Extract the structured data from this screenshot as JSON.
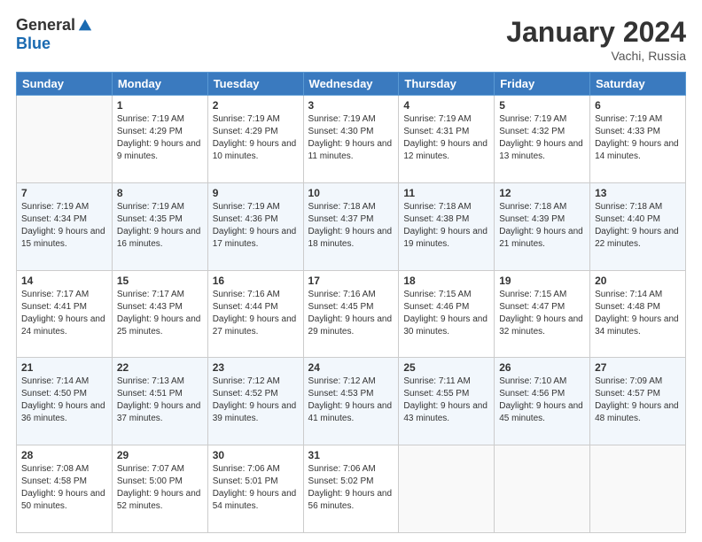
{
  "logo": {
    "general": "General",
    "blue": "Blue"
  },
  "title": "January 2024",
  "location": "Vachi, Russia",
  "days_of_week": [
    "Sunday",
    "Monday",
    "Tuesday",
    "Wednesday",
    "Thursday",
    "Friday",
    "Saturday"
  ],
  "weeks": [
    [
      {
        "day": "",
        "sunrise": "",
        "sunset": "",
        "daylight": ""
      },
      {
        "day": "1",
        "sunrise": "Sunrise: 7:19 AM",
        "sunset": "Sunset: 4:29 PM",
        "daylight": "Daylight: 9 hours and 9 minutes."
      },
      {
        "day": "2",
        "sunrise": "Sunrise: 7:19 AM",
        "sunset": "Sunset: 4:29 PM",
        "daylight": "Daylight: 9 hours and 10 minutes."
      },
      {
        "day": "3",
        "sunrise": "Sunrise: 7:19 AM",
        "sunset": "Sunset: 4:30 PM",
        "daylight": "Daylight: 9 hours and 11 minutes."
      },
      {
        "day": "4",
        "sunrise": "Sunrise: 7:19 AM",
        "sunset": "Sunset: 4:31 PM",
        "daylight": "Daylight: 9 hours and 12 minutes."
      },
      {
        "day": "5",
        "sunrise": "Sunrise: 7:19 AM",
        "sunset": "Sunset: 4:32 PM",
        "daylight": "Daylight: 9 hours and 13 minutes."
      },
      {
        "day": "6",
        "sunrise": "Sunrise: 7:19 AM",
        "sunset": "Sunset: 4:33 PM",
        "daylight": "Daylight: 9 hours and 14 minutes."
      }
    ],
    [
      {
        "day": "7",
        "sunrise": "Sunrise: 7:19 AM",
        "sunset": "Sunset: 4:34 PM",
        "daylight": "Daylight: 9 hours and 15 minutes."
      },
      {
        "day": "8",
        "sunrise": "Sunrise: 7:19 AM",
        "sunset": "Sunset: 4:35 PM",
        "daylight": "Daylight: 9 hours and 16 minutes."
      },
      {
        "day": "9",
        "sunrise": "Sunrise: 7:19 AM",
        "sunset": "Sunset: 4:36 PM",
        "daylight": "Daylight: 9 hours and 17 minutes."
      },
      {
        "day": "10",
        "sunrise": "Sunrise: 7:18 AM",
        "sunset": "Sunset: 4:37 PM",
        "daylight": "Daylight: 9 hours and 18 minutes."
      },
      {
        "day": "11",
        "sunrise": "Sunrise: 7:18 AM",
        "sunset": "Sunset: 4:38 PM",
        "daylight": "Daylight: 9 hours and 19 minutes."
      },
      {
        "day": "12",
        "sunrise": "Sunrise: 7:18 AM",
        "sunset": "Sunset: 4:39 PM",
        "daylight": "Daylight: 9 hours and 21 minutes."
      },
      {
        "day": "13",
        "sunrise": "Sunrise: 7:18 AM",
        "sunset": "Sunset: 4:40 PM",
        "daylight": "Daylight: 9 hours and 22 minutes."
      }
    ],
    [
      {
        "day": "14",
        "sunrise": "Sunrise: 7:17 AM",
        "sunset": "Sunset: 4:41 PM",
        "daylight": "Daylight: 9 hours and 24 minutes."
      },
      {
        "day": "15",
        "sunrise": "Sunrise: 7:17 AM",
        "sunset": "Sunset: 4:43 PM",
        "daylight": "Daylight: 9 hours and 25 minutes."
      },
      {
        "day": "16",
        "sunrise": "Sunrise: 7:16 AM",
        "sunset": "Sunset: 4:44 PM",
        "daylight": "Daylight: 9 hours and 27 minutes."
      },
      {
        "day": "17",
        "sunrise": "Sunrise: 7:16 AM",
        "sunset": "Sunset: 4:45 PM",
        "daylight": "Daylight: 9 hours and 29 minutes."
      },
      {
        "day": "18",
        "sunrise": "Sunrise: 7:15 AM",
        "sunset": "Sunset: 4:46 PM",
        "daylight": "Daylight: 9 hours and 30 minutes."
      },
      {
        "day": "19",
        "sunrise": "Sunrise: 7:15 AM",
        "sunset": "Sunset: 4:47 PM",
        "daylight": "Daylight: 9 hours and 32 minutes."
      },
      {
        "day": "20",
        "sunrise": "Sunrise: 7:14 AM",
        "sunset": "Sunset: 4:48 PM",
        "daylight": "Daylight: 9 hours and 34 minutes."
      }
    ],
    [
      {
        "day": "21",
        "sunrise": "Sunrise: 7:14 AM",
        "sunset": "Sunset: 4:50 PM",
        "daylight": "Daylight: 9 hours and 36 minutes."
      },
      {
        "day": "22",
        "sunrise": "Sunrise: 7:13 AM",
        "sunset": "Sunset: 4:51 PM",
        "daylight": "Daylight: 9 hours and 37 minutes."
      },
      {
        "day": "23",
        "sunrise": "Sunrise: 7:12 AM",
        "sunset": "Sunset: 4:52 PM",
        "daylight": "Daylight: 9 hours and 39 minutes."
      },
      {
        "day": "24",
        "sunrise": "Sunrise: 7:12 AM",
        "sunset": "Sunset: 4:53 PM",
        "daylight": "Daylight: 9 hours and 41 minutes."
      },
      {
        "day": "25",
        "sunrise": "Sunrise: 7:11 AM",
        "sunset": "Sunset: 4:55 PM",
        "daylight": "Daylight: 9 hours and 43 minutes."
      },
      {
        "day": "26",
        "sunrise": "Sunrise: 7:10 AM",
        "sunset": "Sunset: 4:56 PM",
        "daylight": "Daylight: 9 hours and 45 minutes."
      },
      {
        "day": "27",
        "sunrise": "Sunrise: 7:09 AM",
        "sunset": "Sunset: 4:57 PM",
        "daylight": "Daylight: 9 hours and 48 minutes."
      }
    ],
    [
      {
        "day": "28",
        "sunrise": "Sunrise: 7:08 AM",
        "sunset": "Sunset: 4:58 PM",
        "daylight": "Daylight: 9 hours and 50 minutes."
      },
      {
        "day": "29",
        "sunrise": "Sunrise: 7:07 AM",
        "sunset": "Sunset: 5:00 PM",
        "daylight": "Daylight: 9 hours and 52 minutes."
      },
      {
        "day": "30",
        "sunrise": "Sunrise: 7:06 AM",
        "sunset": "Sunset: 5:01 PM",
        "daylight": "Daylight: 9 hours and 54 minutes."
      },
      {
        "day": "31",
        "sunrise": "Sunrise: 7:06 AM",
        "sunset": "Sunset: 5:02 PM",
        "daylight": "Daylight: 9 hours and 56 minutes."
      },
      {
        "day": "",
        "sunrise": "",
        "sunset": "",
        "daylight": ""
      },
      {
        "day": "",
        "sunrise": "",
        "sunset": "",
        "daylight": ""
      },
      {
        "day": "",
        "sunrise": "",
        "sunset": "",
        "daylight": ""
      }
    ]
  ]
}
